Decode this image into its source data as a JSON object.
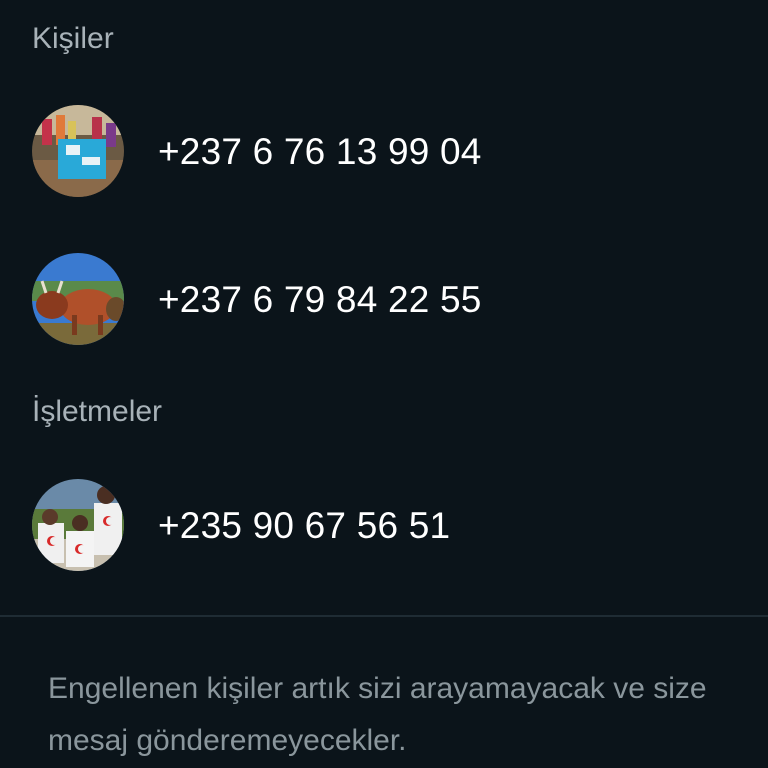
{
  "sections": {
    "contacts_header": "Kişiler",
    "businesses_header": "İşletmeler"
  },
  "contacts": [
    {
      "phone": "+237 6 76 13 99 04",
      "avatar": "group-photo-blue-sign"
    },
    {
      "phone": "+237 6 79 84 22 55",
      "avatar": "cattle-photo"
    }
  ],
  "businesses": [
    {
      "phone": "+235 90 67 56 51",
      "avatar": "children-red-crescent-photo"
    }
  ],
  "footer": {
    "text": "Engellenen kişiler artık sizi arayamayacak ve size mesaj gönderemeyecekler."
  },
  "colors": {
    "background": "#0b141a",
    "header_text": "#a8b2b8",
    "primary_text": "#ffffff",
    "secondary_text": "#8a969c",
    "divider": "#1f2c34"
  }
}
